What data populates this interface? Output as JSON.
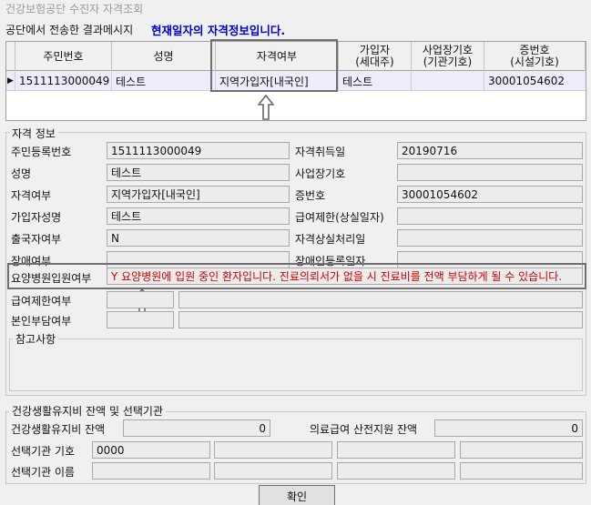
{
  "window": {
    "title": "건강보험공단 수진자 자격조회"
  },
  "message": {
    "prefix": "공단에서 전송한 결과메시지",
    "bold": "현재일자의 자격정보입니다."
  },
  "grid": {
    "columns": [
      "주민번호",
      "성명",
      "자격여부",
      "가입자\n(세대주)",
      "사업장기호\n(기관기호)",
      "증번호\n(시설기호)"
    ],
    "row": {
      "indicator": "▶",
      "jumin": "1511113000049",
      "name": "테스트",
      "status": "지역가입자[내국인]",
      "subscriber": "테스트",
      "workplace": "",
      "cert_no": "30001054602"
    }
  },
  "qual": {
    "title": "자격 정보",
    "labels": {
      "jumin": "주민등록번호",
      "acq_date": "자격취득일",
      "name": "성명",
      "workplace": "사업장기호",
      "status": "자격여부",
      "cert_no": "증번호",
      "subscriber": "가입자성명",
      "benefit_limit": "급여제한(상실일자)",
      "departure": "출국자여부",
      "loss_proc": "자격상실처리일",
      "disabled": "장애여부",
      "disabled_reg": "장애인등록일자",
      "nursing": "요양병원입원여부",
      "benefit_limit2": "급여제한여부",
      "self_pay": "본인부담여부",
      "notes": "참고사항"
    },
    "values": {
      "jumin": "1511113000049",
      "acq_date": "20190716",
      "name": "테스트",
      "workplace": "",
      "status": "지역가입자[내국인]",
      "cert_no": "30001054602",
      "subscriber": "테스트",
      "benefit_limit": "",
      "departure": "N",
      "loss_proc": "",
      "disabled": "",
      "disabled_reg": "",
      "nursing": "Y 요양병원에 입원 중인 환자입니다. 진료의뢰서가 없을 시 진료비를 전액 부담하게 될 수 있습니다."
    }
  },
  "health": {
    "title": "건강생활유지비 잔액 및 선택기관",
    "balance_label": "건강생활유지비 잔액",
    "balance_value": "0",
    "medical_label": "의료급여 산전지원 잔액",
    "medical_value": "0",
    "inst_code_label": "선택기관 기호",
    "inst_code_value": "0000",
    "inst_name_label": "선택기관 이름"
  },
  "confirm_label": "확인",
  "icons": {
    "arrow": "up-arrow-icon"
  }
}
